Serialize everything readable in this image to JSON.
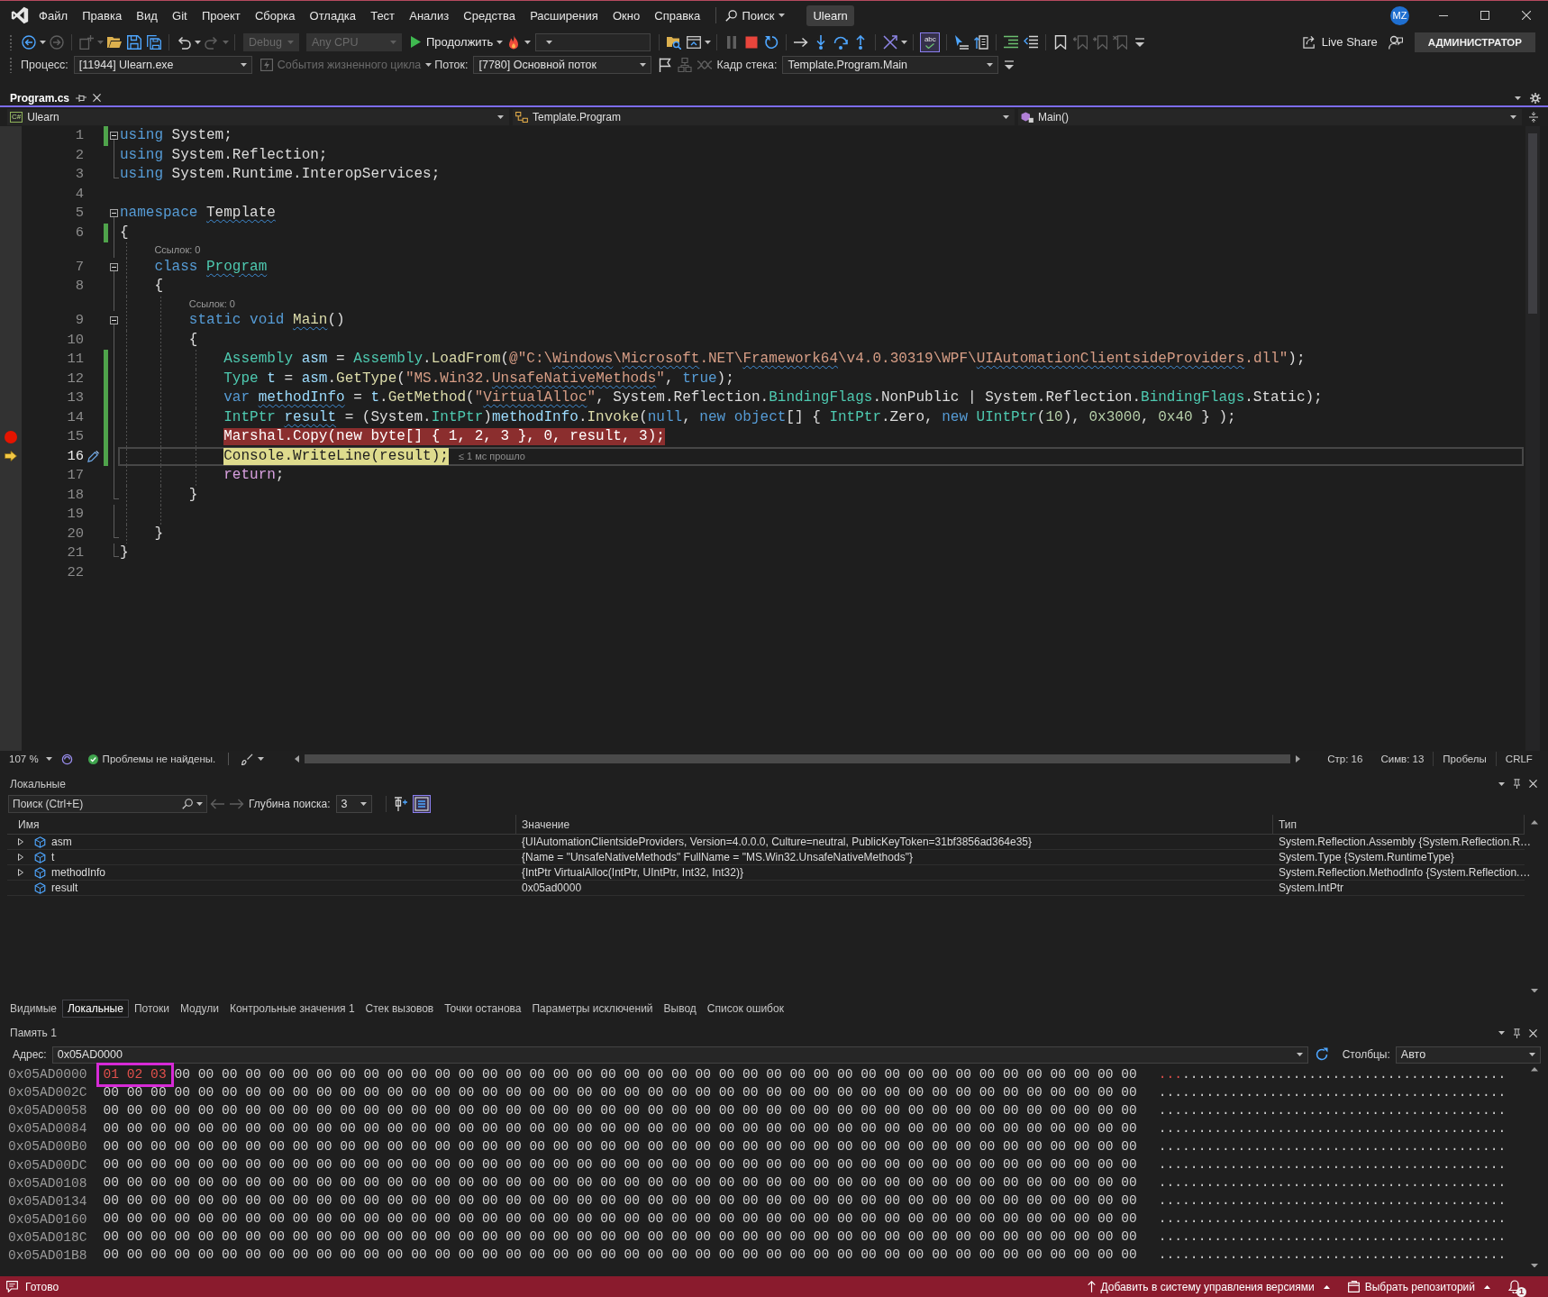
{
  "title_bar": {
    "menu": [
      "Файл",
      "Правка",
      "Вид",
      "Git",
      "Проект",
      "Сборка",
      "Отладка",
      "Тест",
      "Анализ",
      "Средства",
      "Расширения",
      "Окно",
      "Справка"
    ],
    "search": "Поиск",
    "solution": "Ulearn",
    "avatar": "MZ"
  },
  "toolbar": {
    "groups": [
      [
        {
          "kind": "back",
          "disabled": false,
          "caret": true
        },
        {
          "kind": "forward",
          "disabled": true
        }
      ],
      [
        {
          "kind": "new-item",
          "disabled": true,
          "caret": true
        },
        {
          "kind": "open",
          "disabled": false
        },
        {
          "kind": "save",
          "disabled": false
        },
        {
          "kind": "save-all",
          "disabled": false
        }
      ],
      [
        {
          "kind": "undo",
          "disabled": false,
          "caret": true
        },
        {
          "kind": "redo",
          "disabled": true,
          "caret": true
        }
      ],
      [
        {
          "kind": "config-combo",
          "disabled": true,
          "value": "Debug"
        },
        {
          "kind": "platform-combo",
          "disabled": true,
          "value": "Any CPU"
        },
        {
          "kind": "continue",
          "disabled": false,
          "label": "Продолжить",
          "caret": true
        },
        {
          "kind": "fire",
          "disabled": false,
          "caret": true
        },
        {
          "kind": "target-combo",
          "disabled": false
        }
      ],
      [
        {
          "kind": "folder-search",
          "disabled": false
        },
        {
          "kind": "window",
          "disabled": false,
          "caret": true
        }
      ],
      [
        {
          "kind": "pause",
          "disabled": true
        },
        {
          "kind": "stop",
          "disabled": false
        },
        {
          "kind": "restart",
          "disabled": false
        }
      ],
      [
        {
          "kind": "show-next",
          "disabled": false
        },
        {
          "kind": "step-into",
          "disabled": false
        },
        {
          "kind": "step-over",
          "disabled": false
        },
        {
          "kind": "step-out",
          "disabled": false
        }
      ],
      [
        {
          "kind": "crossed",
          "disabled": false,
          "caret": true
        }
      ],
      [
        {
          "kind": "spell",
          "disabled": false,
          "on": true,
          "label": "abc"
        }
      ],
      [
        {
          "kind": "cursor",
          "disabled": false
        },
        {
          "kind": "doc-arrow",
          "disabled": false
        }
      ],
      [
        {
          "kind": "indent",
          "disabled": false
        },
        {
          "kind": "outdent",
          "disabled": false
        }
      ],
      [
        {
          "kind": "bookmark",
          "disabled": false
        },
        {
          "kind": "bookmark-prev",
          "disabled": true
        },
        {
          "kind": "bookmark-next",
          "disabled": true
        },
        {
          "kind": "bookmark-clear",
          "disabled": true
        },
        {
          "kind": "overflow",
          "disabled": false
        }
      ]
    ],
    "live_share": "Live Share",
    "account": "АДМИНИСТРАТОР"
  },
  "debug_location": {
    "process_label": "Процесс:",
    "process": "[11944] Ulearn.exe",
    "lifecycle": {
      "label": "События жизненного цикла",
      "disabled": true
    },
    "thread_label": "Поток:",
    "thread": "[7780] Основной поток",
    "tools": [
      {
        "kind": "flag",
        "disabled": false
      },
      {
        "kind": "threads",
        "disabled": true
      },
      {
        "kind": "ribbon",
        "disabled": true
      }
    ],
    "frame_label": "Кадр стека:",
    "frame": "Template.Program.Main"
  },
  "editor": {
    "tabs": [
      {
        "title": "Program.cs",
        "selected": true
      }
    ],
    "nav": {
      "language": "C#",
      "project": "Ulearn",
      "type": "Template.Program",
      "member": "Main()"
    },
    "lines": [
      {
        "kind": "code",
        "number": "1",
        "changed": true,
        "collapsible": true,
        "region_end": false,
        "breakpoint": false,
        "current": false,
        "tokens": [
          {
            "text": "using ",
            "kind": "kw"
          },
          {
            "text": "System;",
            "kind": "plain"
          }
        ]
      },
      {
        "kind": "code",
        "number": "2",
        "changed": false,
        "collapsible": false,
        "region_end": false,
        "breakpoint": false,
        "current": false,
        "tokens": [
          {
            "text": "using ",
            "kind": "kw"
          },
          {
            "text": "System.Reflection;",
            "kind": "plain"
          }
        ]
      },
      {
        "kind": "code",
        "number": "3",
        "changed": false,
        "collapsible": false,
        "region_end": true,
        "breakpoint": false,
        "current": false,
        "tokens": [
          {
            "text": "using ",
            "kind": "kw"
          },
          {
            "text": "System.Runtime.InteropServices;",
            "kind": "plain"
          }
        ]
      },
      {
        "kind": "code",
        "number": "4",
        "changed": false,
        "collapsible": false,
        "region_end": false,
        "breakpoint": false,
        "current": false
      },
      {
        "kind": "code",
        "number": "5",
        "changed": false,
        "collapsible": true,
        "region_end": false,
        "breakpoint": false,
        "current": false,
        "tokens": [
          {
            "text": "namespace ",
            "kind": "kw"
          },
          {
            "text": "Template",
            "kind": "plain",
            "squiggle": true
          }
        ]
      },
      {
        "kind": "code",
        "number": "6",
        "changed": true,
        "collapsible": false,
        "region_end": false,
        "breakpoint": false,
        "current": false,
        "tokens": [
          {
            "text": "{",
            "kind": "plain"
          }
        ],
        "children": [
          {
            "kind": "codelens",
            "text": "Ссылок: 0"
          },
          {
            "kind": "code",
            "number": "7",
            "changed": false,
            "collapsible": true,
            "region_end": false,
            "breakpoint": false,
            "current": false,
            "tokens": [
              {
                "text": "class ",
                "kind": "kw"
              },
              {
                "text": "Program",
                "kind": "type",
                "squiggle": true
              }
            ]
          },
          {
            "kind": "code",
            "number": "8",
            "changed": false,
            "collapsible": false,
            "region_end": false,
            "breakpoint": false,
            "current": false,
            "tokens": [
              {
                "text": "{",
                "kind": "plain"
              }
            ],
            "children": [
              {
                "kind": "codelens",
                "text": "Ссылок: 0"
              },
              {
                "kind": "code",
                "number": "9",
                "changed": false,
                "collapsible": true,
                "region_end": false,
                "breakpoint": false,
                "current": false,
                "tokens": [
                  {
                    "text": "static void ",
                    "kind": "kw"
                  },
                  {
                    "text": "Main",
                    "kind": "method",
                    "squiggle": true
                  },
                  {
                    "text": "()",
                    "kind": "plain"
                  }
                ]
              },
              {
                "kind": "code",
                "number": "10",
                "changed": false,
                "collapsible": false,
                "region_end": false,
                "breakpoint": false,
                "current": false,
                "tokens": [
                  {
                    "text": "{",
                    "kind": "plain"
                  }
                ],
                "children": [
                  {
                    "kind": "code",
                    "number": "11",
                    "changed": true,
                    "collapsible": false,
                    "region_end": false,
                    "breakpoint": false,
                    "current": false,
                    "tokens": [
                      {
                        "text": "Assembly ",
                        "kind": "type"
                      },
                      {
                        "text": "asm",
                        "kind": "var"
                      },
                      {
                        "text": " = ",
                        "kind": "plain"
                      },
                      {
                        "text": "Assembly",
                        "kind": "type"
                      },
                      {
                        "text": ".",
                        "kind": "plain"
                      },
                      {
                        "text": "LoadFrom",
                        "kind": "method"
                      },
                      {
                        "text": "(",
                        "kind": "plain"
                      },
                      {
                        "text": "@\"C:\\",
                        "kind": "str"
                      },
                      {
                        "text": "Windows",
                        "kind": "str",
                        "squiggle": true
                      },
                      {
                        "text": "\\",
                        "kind": "str"
                      },
                      {
                        "text": "Microsoft",
                        "kind": "str",
                        "squiggle": true
                      },
                      {
                        "text": ".NET\\",
                        "kind": "str"
                      },
                      {
                        "text": "Framework64",
                        "kind": "str",
                        "squiggle": true
                      },
                      {
                        "text": "\\v4.0.30319\\WPF\\",
                        "kind": "str"
                      },
                      {
                        "text": "UIAutomationClientsideProviders",
                        "kind": "str",
                        "squiggle": true
                      },
                      {
                        "text": ".dll\"",
                        "kind": "str"
                      },
                      {
                        "text": ");",
                        "kind": "plain"
                      }
                    ]
                  },
                  {
                    "kind": "code",
                    "number": "12",
                    "changed": true,
                    "collapsible": false,
                    "region_end": false,
                    "breakpoint": false,
                    "current": false,
                    "tokens": [
                      {
                        "text": "Type ",
                        "kind": "type"
                      },
                      {
                        "text": "t",
                        "kind": "var"
                      },
                      {
                        "text": " = ",
                        "kind": "plain"
                      },
                      {
                        "text": "asm",
                        "kind": "var"
                      },
                      {
                        "text": ".",
                        "kind": "plain"
                      },
                      {
                        "text": "GetType",
                        "kind": "method"
                      },
                      {
                        "text": "(",
                        "kind": "plain"
                      },
                      {
                        "text": "\"MS.Win32.",
                        "kind": "str"
                      },
                      {
                        "text": "UnsafeNativeMethods",
                        "kind": "str",
                        "squiggle": true
                      },
                      {
                        "text": "\"",
                        "kind": "str"
                      },
                      {
                        "text": ", ",
                        "kind": "plain"
                      },
                      {
                        "text": "true",
                        "kind": "kw"
                      },
                      {
                        "text": ");",
                        "kind": "plain"
                      }
                    ]
                  },
                  {
                    "kind": "code",
                    "number": "13",
                    "changed": true,
                    "collapsible": false,
                    "region_end": false,
                    "breakpoint": false,
                    "current": false,
                    "tokens": [
                      {
                        "text": "var ",
                        "kind": "kw"
                      },
                      {
                        "text": "methodInfo",
                        "kind": "var",
                        "squiggle": true
                      },
                      {
                        "text": " = ",
                        "kind": "plain"
                      },
                      {
                        "text": "t",
                        "kind": "var"
                      },
                      {
                        "text": ".",
                        "kind": "plain"
                      },
                      {
                        "text": "GetMethod",
                        "kind": "method"
                      },
                      {
                        "text": "(",
                        "kind": "plain"
                      },
                      {
                        "text": "\"",
                        "kind": "str"
                      },
                      {
                        "text": "VirtualAlloc",
                        "kind": "str",
                        "squiggle": true
                      },
                      {
                        "text": "\"",
                        "kind": "str"
                      },
                      {
                        "text": ", System.Reflection.",
                        "kind": "plain"
                      },
                      {
                        "text": "BindingFlags",
                        "kind": "type"
                      },
                      {
                        "text": ".NonPublic | System.Reflection.",
                        "kind": "plain"
                      },
                      {
                        "text": "BindingFlags",
                        "kind": "type"
                      },
                      {
                        "text": ".Static);",
                        "kind": "plain"
                      }
                    ]
                  },
                  {
                    "kind": "code",
                    "number": "14",
                    "changed": true,
                    "collapsible": false,
                    "region_end": false,
                    "breakpoint": false,
                    "current": false,
                    "tokens": [
                      {
                        "text": "IntPtr ",
                        "kind": "type"
                      },
                      {
                        "text": "result",
                        "kind": "var",
                        "squiggle": true
                      },
                      {
                        "text": " = (System.",
                        "kind": "plain"
                      },
                      {
                        "text": "IntPtr",
                        "kind": "type"
                      },
                      {
                        "text": ")",
                        "kind": "plain"
                      },
                      {
                        "text": "methodInfo",
                        "kind": "var"
                      },
                      {
                        "text": ".",
                        "kind": "plain"
                      },
                      {
                        "text": "Invoke",
                        "kind": "method"
                      },
                      {
                        "text": "(",
                        "kind": "plain"
                      },
                      {
                        "text": "null",
                        "kind": "kw"
                      },
                      {
                        "text": ", ",
                        "kind": "plain"
                      },
                      {
                        "text": "new object",
                        "kind": "kw"
                      },
                      {
                        "text": "[] { ",
                        "kind": "plain"
                      },
                      {
                        "text": "IntPtr",
                        "kind": "type"
                      },
                      {
                        "text": ".Zero, ",
                        "kind": "plain"
                      },
                      {
                        "text": "new ",
                        "kind": "kw"
                      },
                      {
                        "text": "UIntPtr",
                        "kind": "type"
                      },
                      {
                        "text": "(",
                        "kind": "plain"
                      },
                      {
                        "text": "10",
                        "kind": "num"
                      },
                      {
                        "text": "), ",
                        "kind": "plain"
                      },
                      {
                        "text": "0x3000",
                        "kind": "num"
                      },
                      {
                        "text": ", ",
                        "kind": "plain"
                      },
                      {
                        "text": "0x40",
                        "kind": "num"
                      },
                      {
                        "text": " } );",
                        "kind": "plain"
                      }
                    ]
                  },
                  {
                    "kind": "code",
                    "number": "15",
                    "changed": true,
                    "collapsible": false,
                    "region_end": false,
                    "breakpoint": true,
                    "current": false,
                    "tokens": [
                      {
                        "text": "Marshal.Copy(new byte[] { 1, 2, 3 }, 0, result, 3);",
                        "kind": "emph"
                      }
                    ]
                  },
                  {
                    "kind": "code",
                    "number": "16",
                    "changed": true,
                    "collapsible": false,
                    "region_end": false,
                    "breakpoint": false,
                    "current": true,
                    "tokens": [
                      {
                        "text": "Console.WriteLine(result);",
                        "kind": "stmt"
                      }
                    ],
                    "hint": "≤ 1 мс прошло"
                  },
                  {
                    "kind": "code",
                    "number": "17",
                    "changed": false,
                    "collapsible": false,
                    "region_end": false,
                    "breakpoint": false,
                    "current": false,
                    "tokens": [
                      {
                        "text": "return",
                        "kind": "ctl"
                      },
                      {
                        "text": ";",
                        "kind": "plain"
                      }
                    ]
                  }
                ]
              },
              {
                "kind": "code",
                "number": "18",
                "changed": false,
                "collapsible": false,
                "region_end": true,
                "breakpoint": false,
                "current": false,
                "tokens": [
                  {
                    "text": "}",
                    "kind": "plain"
                  }
                ]
              },
              {
                "kind": "code",
                "number": "19",
                "changed": false,
                "collapsible": false,
                "region_end": false,
                "breakpoint": false,
                "current": false
              }
            ]
          },
          {
            "kind": "code",
            "number": "20",
            "changed": false,
            "collapsible": false,
            "region_end": true,
            "breakpoint": false,
            "current": false,
            "tokens": [
              {
                "text": "}",
                "kind": "plain"
              }
            ]
          }
        ]
      },
      {
        "kind": "code",
        "number": "21",
        "changed": false,
        "collapsible": false,
        "region_end": true,
        "breakpoint": false,
        "current": false,
        "tokens": [
          {
            "text": "}",
            "kind": "plain"
          }
        ]
      },
      {
        "kind": "code",
        "number": "22",
        "changed": false,
        "collapsible": false,
        "region_end": false,
        "breakpoint": false,
        "current": false
      }
    ],
    "status": {
      "zoom": "107 %",
      "issues": "Проблемы не найдены.",
      "line": "Стр: 16",
      "column": "Симв: 13",
      "indentation": "Пробелы",
      "line_endings": "CRLF"
    }
  },
  "locals": {
    "title": "Локальные",
    "search_placeholder": "Поиск (Ctrl+E)",
    "history": [
      {
        "kind": "left",
        "disabled": true
      },
      {
        "kind": "right",
        "disabled": true
      }
    ],
    "depth_label": "Глубина поиска:",
    "depth": "3",
    "tools": [
      {
        "kind": "pin-up",
        "on": false
      },
      {
        "kind": "box-lines",
        "on": true
      }
    ],
    "columns": [
      "Имя",
      "Значение",
      "Тип"
    ],
    "rows": [
      {
        "name": "asm",
        "value": "{UIAutomationClientsideProviders, Version=4.0.0.0, Culture=neutral, PublicKeyToken=31bf3856ad364e35}",
        "type": "System.Reflection.Assembly {System.Reflection.R…",
        "expandable": true,
        "expanded": false
      },
      {
        "name": "t",
        "value": "{Name = \"UnsafeNativeMethods\" FullName = \"MS.Win32.UnsafeNativeMethods\"}",
        "type": "System.Type {System.RuntimeType}",
        "expandable": true,
        "expanded": false
      },
      {
        "name": "methodInfo",
        "value": "{IntPtr VirtualAlloc(IntPtr, UIntPtr, Int32, Int32)}",
        "type": "System.Reflection.MethodInfo {System.Reflection.…",
        "expandable": true,
        "expanded": false
      },
      {
        "name": "result",
        "value": "0x05ad0000",
        "type": "System.IntPtr",
        "expandable": false
      }
    ]
  },
  "debug_tabs": [
    {
      "label": "Видимые",
      "selected": false
    },
    {
      "label": "Локальные",
      "selected": true
    },
    {
      "label": "Потоки",
      "selected": false
    },
    {
      "label": "Модули",
      "selected": false
    },
    {
      "label": "Контрольные значения 1",
      "selected": false
    },
    {
      "label": "Стек вызовов",
      "selected": false
    },
    {
      "label": "Точки останова",
      "selected": false
    },
    {
      "label": "Параметры исключений",
      "selected": false
    },
    {
      "label": "Вывод",
      "selected": false
    },
    {
      "label": "Список ошибок",
      "selected": false
    }
  ],
  "memory": {
    "title": "Память 1",
    "address_label": "Адрес:",
    "address": "0x05AD0000",
    "columns_label": "Столбцы:",
    "columns": "Авто",
    "rows": [
      {
        "address": "0x05AD0000",
        "bytes": [
          {
            "text": "01 02 03",
            "changed": true,
            "framed": true
          },
          {
            "text": "00 00 00 00 00 00 00 00 00 00 00 00 00 00 00 00 00 00 00 00 00 00 00 00 00 00 00 00 00 00 00 00 00 00 00 00 00 00 00 00 00",
            "changed": false,
            "framed": false
          }
        ],
        "chars": [
          {
            "text": "...",
            "changed": true
          },
          {
            "text": ".........................................",
            "changed": false
          }
        ]
      },
      {
        "address": "0x05AD002C",
        "bytes": [
          {
            "text": "00 00 00 00 00 00 00 00 00 00 00 00 00 00 00 00 00 00 00 00 00 00 00 00 00 00 00 00 00 00 00 00 00 00 00 00 00 00 00 00 00 00 00 00",
            "changed": false,
            "framed": false
          }
        ],
        "chars": [
          {
            "text": "............................................",
            "changed": false
          }
        ]
      },
      {
        "address": "0x05AD0058",
        "bytes": [
          {
            "text": "00 00 00 00 00 00 00 00 00 00 00 00 00 00 00 00 00 00 00 00 00 00 00 00 00 00 00 00 00 00 00 00 00 00 00 00 00 00 00 00 00 00 00 00",
            "changed": false,
            "framed": false
          }
        ],
        "chars": [
          {
            "text": "............................................",
            "changed": false
          }
        ]
      },
      {
        "address": "0x05AD0084",
        "bytes": [
          {
            "text": "00 00 00 00 00 00 00 00 00 00 00 00 00 00 00 00 00 00 00 00 00 00 00 00 00 00 00 00 00 00 00 00 00 00 00 00 00 00 00 00 00 00 00 00",
            "changed": false,
            "framed": false
          }
        ],
        "chars": [
          {
            "text": "............................................",
            "changed": false
          }
        ]
      },
      {
        "address": "0x05AD00B0",
        "bytes": [
          {
            "text": "00 00 00 00 00 00 00 00 00 00 00 00 00 00 00 00 00 00 00 00 00 00 00 00 00 00 00 00 00 00 00 00 00 00 00 00 00 00 00 00 00 00 00 00",
            "changed": false,
            "framed": false
          }
        ],
        "chars": [
          {
            "text": "............................................",
            "changed": false
          }
        ]
      },
      {
        "address": "0x05AD00DC",
        "bytes": [
          {
            "text": "00 00 00 00 00 00 00 00 00 00 00 00 00 00 00 00 00 00 00 00 00 00 00 00 00 00 00 00 00 00 00 00 00 00 00 00 00 00 00 00 00 00 00 00",
            "changed": false,
            "framed": false
          }
        ],
        "chars": [
          {
            "text": "............................................",
            "changed": false
          }
        ]
      },
      {
        "address": "0x05AD0108",
        "bytes": [
          {
            "text": "00 00 00 00 00 00 00 00 00 00 00 00 00 00 00 00 00 00 00 00 00 00 00 00 00 00 00 00 00 00 00 00 00 00 00 00 00 00 00 00 00 00 00 00",
            "changed": false,
            "framed": false
          }
        ],
        "chars": [
          {
            "text": "............................................",
            "changed": false
          }
        ]
      },
      {
        "address": "0x05AD0134",
        "bytes": [
          {
            "text": "00 00 00 00 00 00 00 00 00 00 00 00 00 00 00 00 00 00 00 00 00 00 00 00 00 00 00 00 00 00 00 00 00 00 00 00 00 00 00 00 00 00 00 00",
            "changed": false,
            "framed": false
          }
        ],
        "chars": [
          {
            "text": "............................................",
            "changed": false
          }
        ]
      },
      {
        "address": "0x05AD0160",
        "bytes": [
          {
            "text": "00 00 00 00 00 00 00 00 00 00 00 00 00 00 00 00 00 00 00 00 00 00 00 00 00 00 00 00 00 00 00 00 00 00 00 00 00 00 00 00 00 00 00 00",
            "changed": false,
            "framed": false
          }
        ],
        "chars": [
          {
            "text": "............................................",
            "changed": false
          }
        ]
      },
      {
        "address": "0x05AD018C",
        "bytes": [
          {
            "text": "00 00 00 00 00 00 00 00 00 00 00 00 00 00 00 00 00 00 00 00 00 00 00 00 00 00 00 00 00 00 00 00 00 00 00 00 00 00 00 00 00 00 00 00",
            "changed": false,
            "framed": false
          }
        ],
        "chars": [
          {
            "text": "............................................",
            "changed": false
          }
        ]
      },
      {
        "address": "0x05AD01B8",
        "bytes": [
          {
            "text": "00 00 00 00 00 00 00 00 00 00 00 00 00 00 00 00 00 00 00 00 00 00 00 00 00 00 00 00 00 00 00 00 00 00 00 00 00 00 00 00 00 00 00 00",
            "changed": false,
            "framed": false
          }
        ],
        "chars": [
          {
            "text": "............................................",
            "changed": false
          }
        ]
      }
    ]
  },
  "status_bar": {
    "text": "Готово",
    "source_control": "Добавить в систему управления версиями",
    "repository": "Выбрать репозиторий",
    "notifications": "1"
  }
}
